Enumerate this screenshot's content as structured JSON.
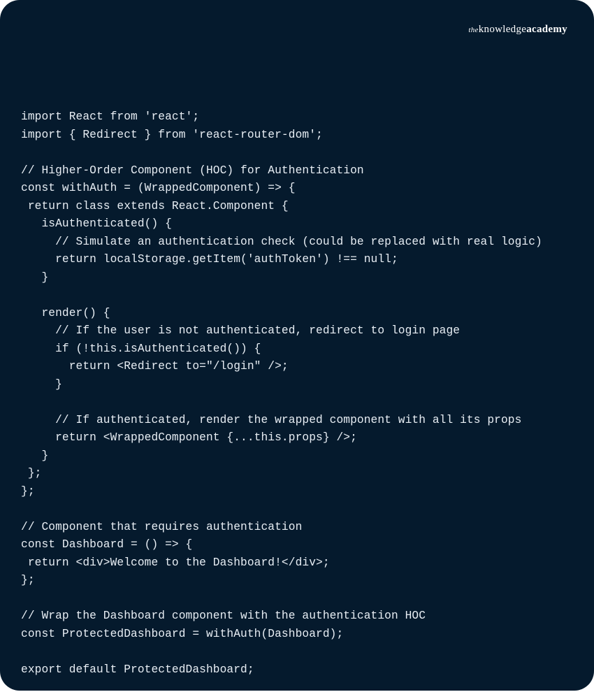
{
  "brand": {
    "the": "the",
    "knowledge": "knowledge",
    "academy": "academy"
  },
  "code": "import React from 'react'; \nimport { Redirect } from 'react-router-dom'; \n \n// Higher-Order Component (HOC) for Authentication \nconst withAuth = (WrappedComponent) => { \n return class extends React.Component { \n   isAuthenticated() { \n     // Simulate an authentication check (could be replaced with real logic) \n     return localStorage.getItem('authToken') !== null; \n   } \n \n   render() { \n     // If the user is not authenticated, redirect to login page \n     if (!this.isAuthenticated()) { \n       return <Redirect to=\"/login\" />; \n     } \n \n     // If authenticated, render the wrapped component with all its props \n     return <WrappedComponent {...this.props} />; \n   } \n }; \n}; \n \n// Component that requires authentication \nconst Dashboard = () => { \n return <div>Welcome to the Dashboard!</div>; \n}; \n \n// Wrap the Dashboard component with the authentication HOC \nconst ProtectedDashboard = withAuth(Dashboard); \n \nexport default ProtectedDashboard; "
}
